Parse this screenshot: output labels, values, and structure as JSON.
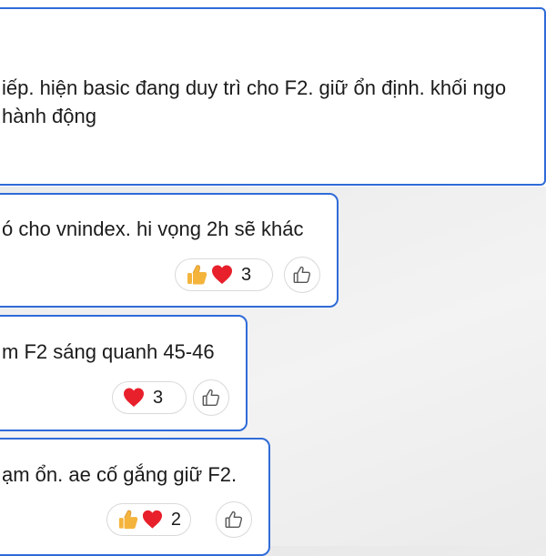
{
  "top_message": {
    "line1": "iếp. hiện basic đang duy trì cho F2. giữ ổn định. khối ngo",
    "line2": "hành động"
  },
  "messages": [
    {
      "text": "ó cho vnindex. hi vọng 2h sẽ khác",
      "reactions": [
        "thumbs-up",
        "heart"
      ],
      "count": "3"
    },
    {
      "text": "m F2 sáng quanh 45-46",
      "reactions": [
        "heart"
      ],
      "count": "3"
    },
    {
      "text": "ạm ổn. ae cố gắng giữ F2.",
      "reactions": [
        "thumbs-up",
        "heart"
      ],
      "count": "2"
    }
  ],
  "colors": {
    "accent_border": "#2f6bd8",
    "heart": "#e8202c",
    "thumb": "#f4b43c"
  },
  "icons": {
    "thumbs_up": "thumbs-up-emoji",
    "heart": "heart-emoji",
    "like_outline": "like-outline-icon"
  }
}
